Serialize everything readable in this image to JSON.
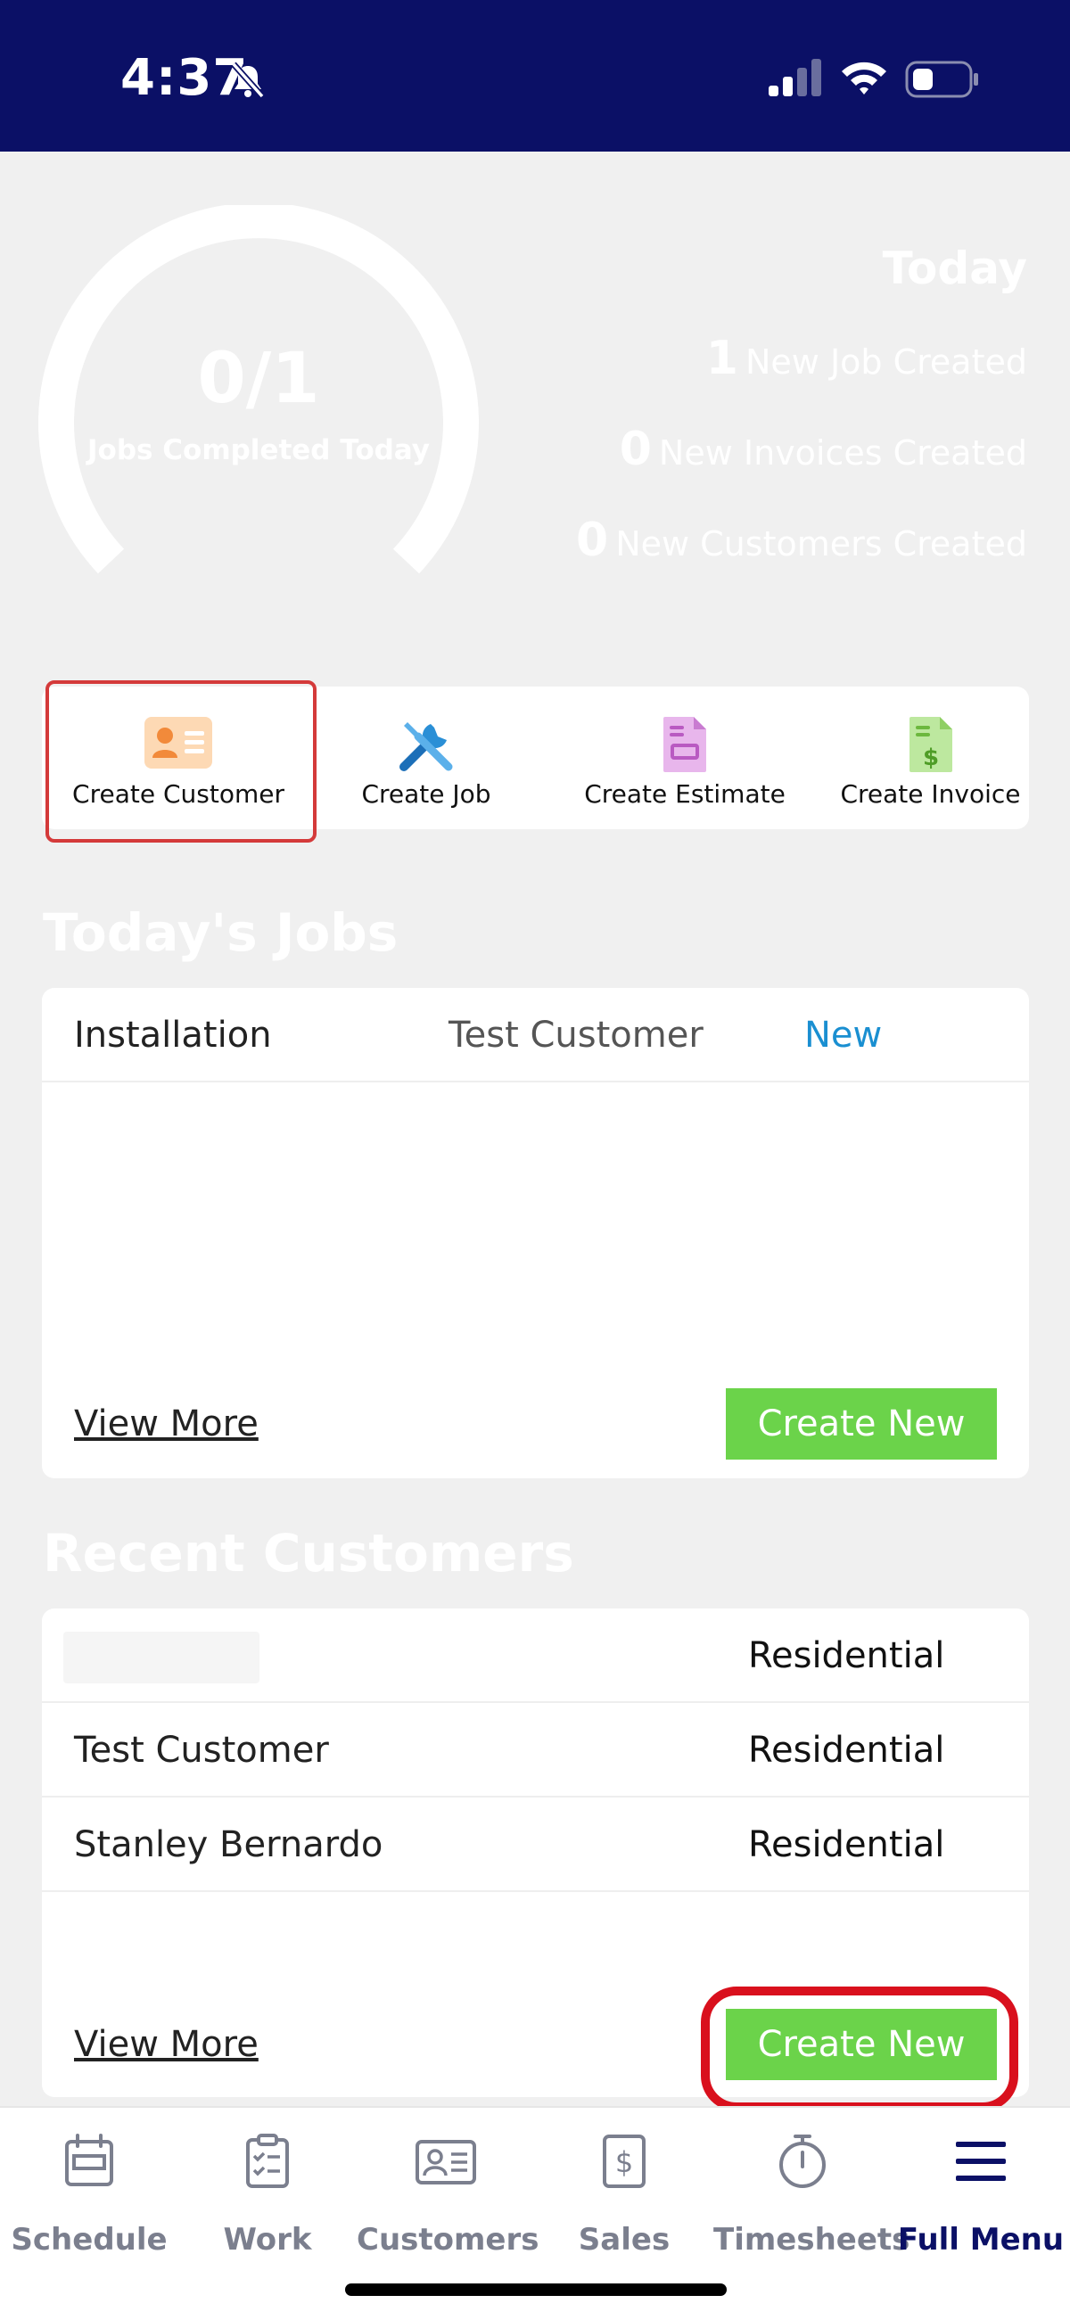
{
  "status_bar": {
    "time": "4:37"
  },
  "stats": {
    "completed": "0/1",
    "completed_label": "Jobs Completed Today",
    "today_title": "Today",
    "new_jobs_count": "1",
    "new_jobs_label": "New Job Created",
    "new_invoices_count": "0",
    "new_invoices_label": "New Invoices Created",
    "new_customers_count": "0",
    "new_customers_label": "New Customers Created",
    "gauge_fraction": 0
  },
  "quick_actions": {
    "create_customer": "Create Customer",
    "create_job": "Create Job",
    "create_estimate": "Create Estimate",
    "create_invoice": "Create Invoice"
  },
  "todays_jobs": {
    "title": "Today's Jobs",
    "jobs": [
      {
        "type": "Installation",
        "customer": "Test Customer",
        "status": "New"
      }
    ],
    "view_more": "View More",
    "create_new": "Create New"
  },
  "recent_customers": {
    "title": "Recent Customers",
    "customers": [
      {
        "name": "",
        "type": "Residential"
      },
      {
        "name": "Test Customer",
        "type": "Residential"
      },
      {
        "name": "Stanley Bernardo",
        "type": "Residential"
      }
    ],
    "view_more": "View More",
    "create_new": "Create New"
  },
  "tabs": {
    "schedule": "Schedule",
    "work": "Work",
    "customers": "Customers",
    "sales": "Sales",
    "timesheets": "Timesheets",
    "full_menu": "Full Menu"
  },
  "colors": {
    "status_bar": "#0b1066",
    "accent_green": "#6bd34a",
    "status_new": "#1a8fd1",
    "highlight_red": "#d9101d"
  }
}
